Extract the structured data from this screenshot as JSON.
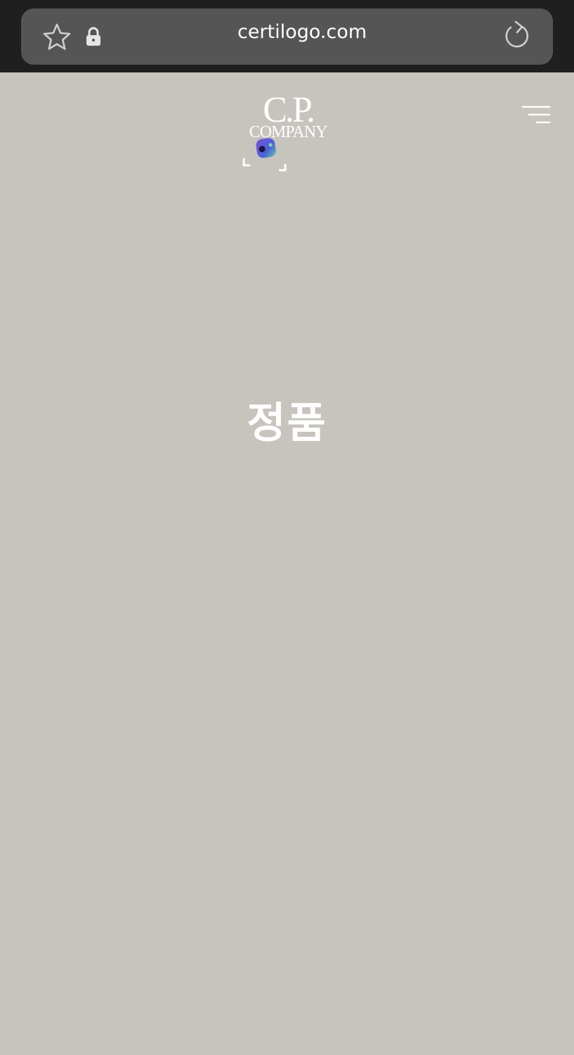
{
  "browser": {
    "url": "certilogo.com",
    "icons": [
      "star-icon",
      "lock-icon",
      "reload-icon"
    ]
  },
  "header": {
    "logo_line1": "C.P.",
    "logo_line2": "COMPANY",
    "menu_icon": "hamburger-menu-icon"
  },
  "main": {
    "status": "정품"
  },
  "colors": {
    "background": "#c7c3bd",
    "chrome": "#1f1f1f",
    "url_bar": "#555555",
    "text": "#ffffff"
  }
}
